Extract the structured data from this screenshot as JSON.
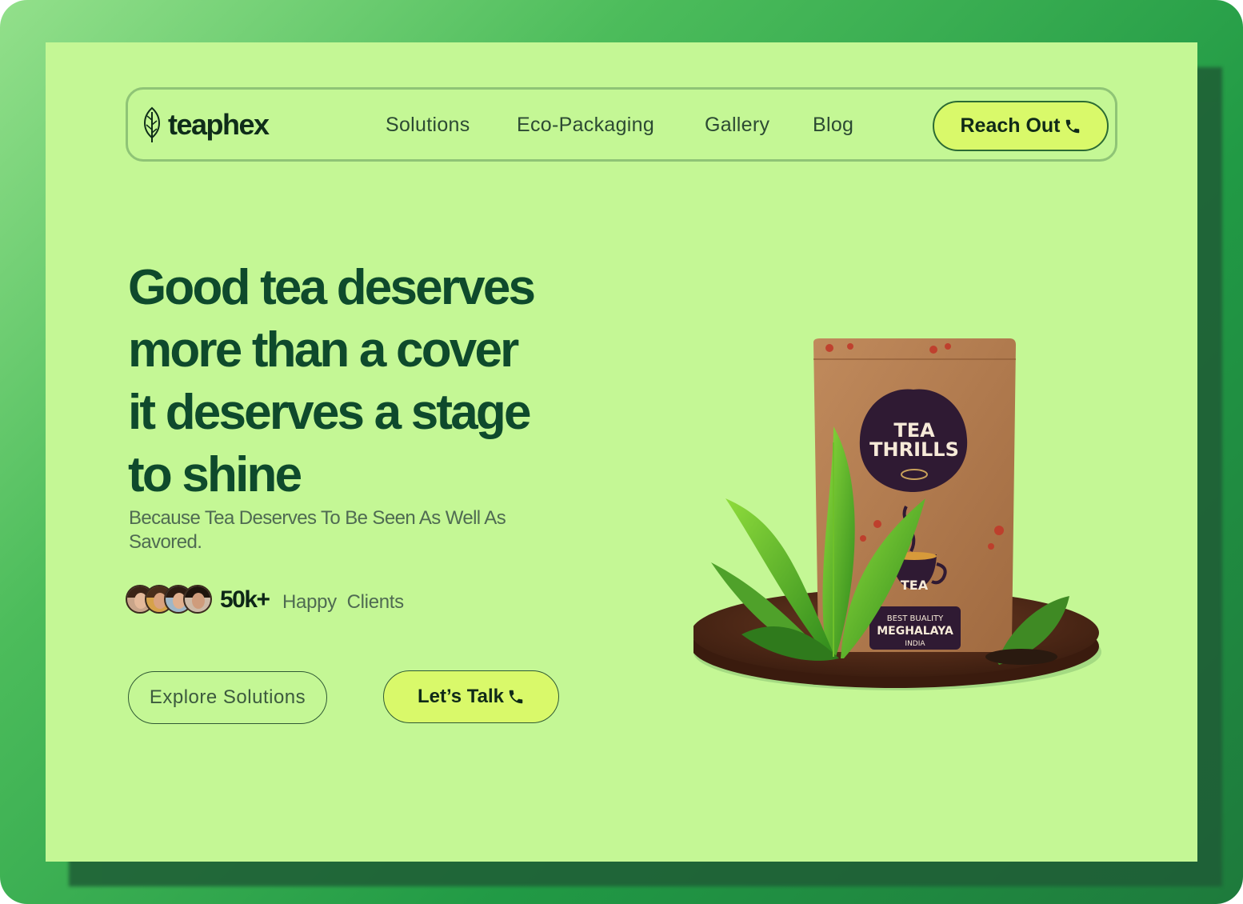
{
  "brand": {
    "name": "teaphex",
    "logo_icon": "leaf-icon"
  },
  "nav": {
    "links": [
      "Solutions",
      "Eco-Packaging",
      "Gallery",
      "Blog"
    ],
    "cta_label": "Reach Out",
    "cta_icon": "phone-icon"
  },
  "hero": {
    "headline_lines": [
      "Good tea deserves",
      "more than a cover",
      "it deserves a stage",
      "to shine"
    ],
    "subheadline": "Because Tea Deserves To Be Seen As Well As Savored.",
    "clients_count": "50k+",
    "clients_label": "Happy  Clients",
    "secondary_cta": "Explore Solutions",
    "primary_cta": "Let’s Talk",
    "primary_cta_icon": "phone-icon"
  },
  "product": {
    "brand_line1": "TEA",
    "brand_line2": "THRILLS",
    "cup_label": "TEA",
    "badge_line1": "BEST BUALITY",
    "badge_line2": "MEGHALAYA",
    "badge_line3": "INDIA"
  },
  "colors": {
    "background": "#c4f795",
    "accent": "#d9f96a",
    "headline": "#0e4a2c",
    "frame": "#219a45"
  }
}
